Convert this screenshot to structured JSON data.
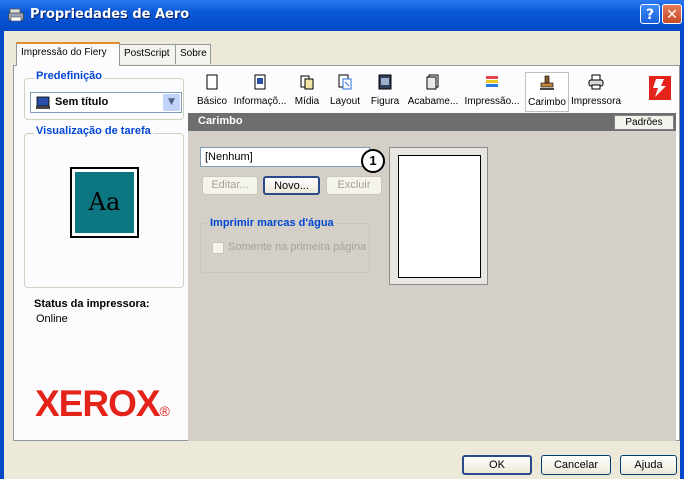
{
  "window": {
    "title": "Propriedades de Aero",
    "help_label": "?",
    "close_label": "✕"
  },
  "top_tabs": [
    {
      "label": "Impressão do Fiery"
    },
    {
      "label": "PostScript"
    },
    {
      "label": "Sobre"
    }
  ],
  "left": {
    "preset_title": "Predefinição",
    "preset_value": "Sem título",
    "preview_title": "Visualização de tarefa",
    "preview_glyph": "Aa",
    "status_label": "Status da impressora:",
    "status_value": "Online",
    "logo_text": "XEROX",
    "logo_suffix": "®"
  },
  "ribbon": [
    {
      "label": "Básico",
      "icon": "page-icon"
    },
    {
      "label": "Informaçõ...",
      "icon": "info-page-icon"
    },
    {
      "label": "Mídia",
      "icon": "media-icon"
    },
    {
      "label": "Layout",
      "icon": "layout-icon"
    },
    {
      "label": "Figura",
      "icon": "image-icon"
    },
    {
      "label": "Acabame...",
      "icon": "finishing-icon"
    },
    {
      "label": "Impressão...",
      "icon": "print-quality-icon"
    },
    {
      "label": "Carimbo",
      "icon": "stamp-icon",
      "selected": true
    },
    {
      "label": "Impressora",
      "icon": "printer-icon"
    },
    {
      "label": "Fiery",
      "icon": "fiery-logo-icon"
    }
  ],
  "section": {
    "title": "Carimbo",
    "defaults_label": "Padrões"
  },
  "stamp": {
    "selection": "[Nenhum]",
    "callout": "1",
    "edit_label": "Editar...",
    "new_label": "Novo...",
    "delete_label": "Excluir",
    "watermark_title": "Imprimir marcas d'água",
    "first_page_label": "Somente na primeira página",
    "first_page_checked": false
  },
  "footer": {
    "ok_label": "OK",
    "cancel_label": "Cancelar",
    "help_label": "Ajuda"
  },
  "colors": {
    "title_bar": "#0a58d8",
    "accent_tab": "#e68b2c",
    "group_title": "#0046d5",
    "logo": "#e4231b",
    "header_bar": "#6e6e6e"
  }
}
